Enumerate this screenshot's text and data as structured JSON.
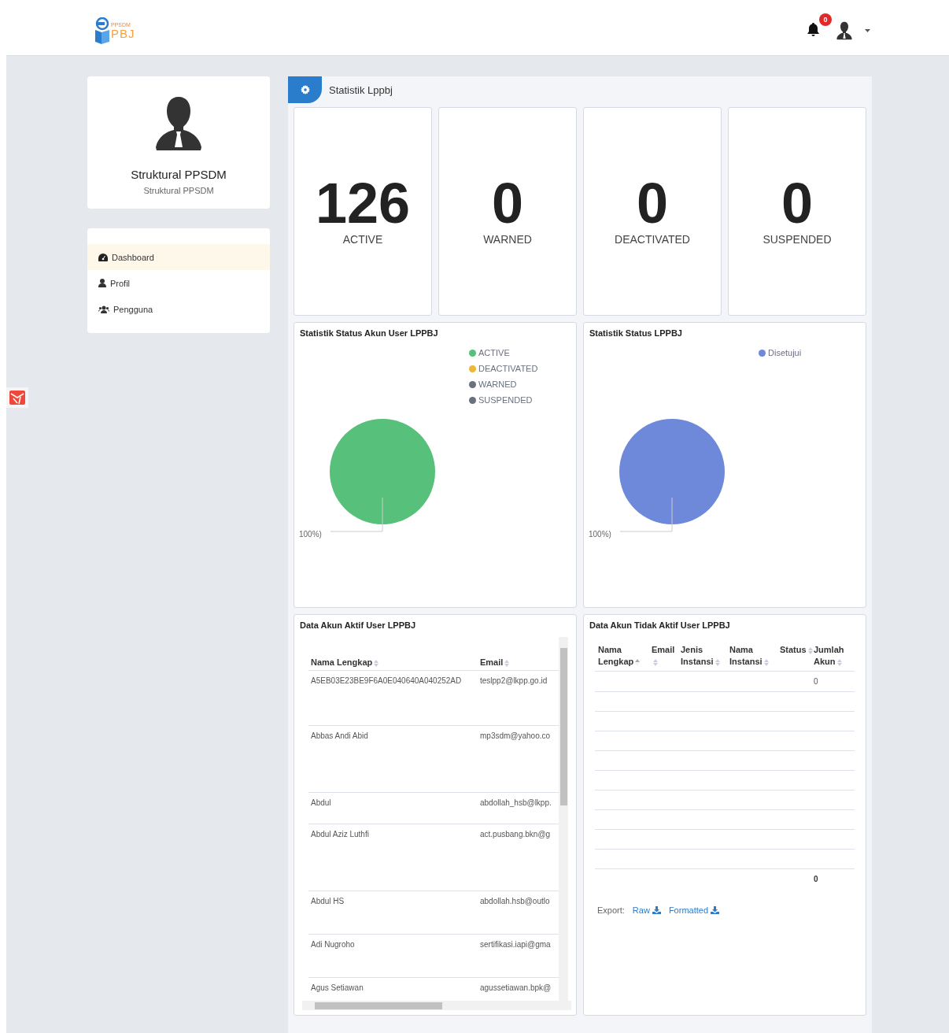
{
  "header": {
    "logo": {
      "top": "PPSDM",
      "bottom": "PBJ"
    },
    "notifications": {
      "count": "0"
    }
  },
  "profile": {
    "name": "Struktural PPSDM",
    "role": "Struktural PPSDM"
  },
  "nav": [
    {
      "label": "Dashboard",
      "selected": true
    },
    {
      "label": "Profil",
      "selected": false
    },
    {
      "label": "Pengguna",
      "selected": false
    }
  ],
  "section": {
    "title": "Statistik Lppbj"
  },
  "stats": [
    {
      "value": "126",
      "label": "ACTIVE"
    },
    {
      "value": "0",
      "label": "WARNED"
    },
    {
      "value": "0",
      "label": "DEACTIVATED"
    },
    {
      "value": "0",
      "label": "SUSPENDED"
    }
  ],
  "charts": [
    {
      "title": "Statistik Status Akun User LPPBJ",
      "slice_label": "100%)",
      "chart_data": {
        "type": "pie",
        "categories": [
          "ACTIVE",
          "DEACTIVATED",
          "WARNED",
          "SUSPENDED"
        ],
        "values": [
          100,
          0,
          0,
          0
        ],
        "colors": [
          "#57c07a",
          "#ecb73a",
          "#6a7080",
          "#6a7080"
        ]
      }
    },
    {
      "title": "Statistik Status LPPBJ",
      "slice_label": "100%)",
      "chart_data": {
        "type": "pie",
        "categories": [
          "Disetujui"
        ],
        "values": [
          100
        ],
        "colors": [
          "#6e88da"
        ]
      }
    }
  ],
  "active_table": {
    "title": "Data Akun Aktif User LPPBJ",
    "columns": [
      {
        "label": "Nama Lengkap",
        "sorted": false
      },
      {
        "label": "Email",
        "sorted": false
      }
    ],
    "rows": [
      [
        "A5EB03E23BE9F6A0E040640A040252AD",
        "teslpp2@lkpp.go.id"
      ],
      [
        "Abbas Andi Abid",
        "mp3sdm@yahoo.co"
      ],
      [
        "Abdul",
        "abdollah_hsb@lkpp."
      ],
      [
        "Abdul Aziz Luthfi",
        "act.pusbang.bkn@g"
      ],
      [
        "Abdul HS",
        "abdollah.hsb@outlo"
      ],
      [
        "Adi Nugroho",
        "sertifikasi.iapi@gma"
      ],
      [
        "Agus Setiawan",
        "agussetiawan.bpk@"
      ]
    ]
  },
  "inactive_table": {
    "title": "Data Akun Tidak Aktif User LPPBJ",
    "columns": [
      {
        "label": "Nama Lengkap",
        "sorted": true
      },
      {
        "label": "Email",
        "sorted": false
      },
      {
        "label": "Jenis Instansi",
        "sorted": false
      },
      {
        "label": "Nama Instansi",
        "sorted": false
      },
      {
        "label": "Status",
        "sorted": false
      },
      {
        "label": "Jumlah Akun",
        "sorted": false
      }
    ],
    "rows": [
      [
        "",
        "",
        "",
        "",
        "",
        "0"
      ]
    ],
    "footer_total": "0",
    "export": {
      "label": "Export:",
      "links": [
        "Raw",
        "Formatted"
      ]
    }
  }
}
